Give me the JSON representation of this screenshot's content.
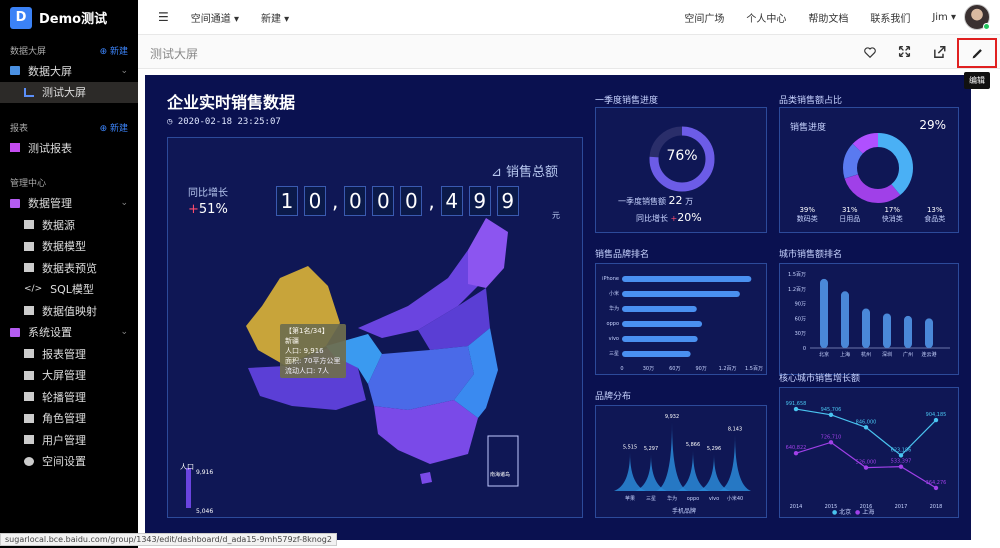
{
  "app": {
    "name": "Demo测试",
    "logo_letter": "D"
  },
  "sidebar": {
    "sections": [
      {
        "title": "数据大屏",
        "new_label": "新建"
      },
      {
        "title": "报表",
        "new_label": "新建"
      },
      {
        "title": "管理中心"
      }
    ],
    "bigscreen_group": "数据大屏",
    "bigscreen_item": "测试大屏",
    "report_item": "测试报表",
    "data_mgmt": "数据管理",
    "data_items": [
      "数据源",
      "数据模型",
      "数据表预览",
      "SQL模型",
      "数据值映射"
    ],
    "settings": "系统设置",
    "settings_items": [
      "报表管理",
      "大屏管理",
      "轮播管理",
      "角色管理",
      "用户管理",
      "空间设置"
    ]
  },
  "topbar": {
    "items": [
      "空间通道",
      "新建"
    ],
    "right_items": [
      "空间广场",
      "个人中心",
      "帮助文档",
      "联系我们"
    ],
    "user": "Jim"
  },
  "subbar": {
    "title": "测试大屏",
    "edit_tooltip": "编辑"
  },
  "dashboard": {
    "title": "企业实时销售数据",
    "datetime": "2020-02-18 23:25:07",
    "sales_total_label": "销售总额",
    "yoy_label": "同比增长",
    "yoy_sign": "+",
    "yoy_value": "51%",
    "digits": [
      "1",
      "0",
      ",",
      "0",
      "0",
      "0",
      ",",
      "4",
      "9",
      "9"
    ],
    "unit": "元",
    "map_tooltip": [
      "【第1名/34】",
      "新疆",
      "人口: 9,916",
      "面积: 70平方公里",
      "流动人口: 7人"
    ],
    "legend_title": "人口",
    "legend_max": "9,916",
    "legend_min": "5,046",
    "south_sea": "南海诸岛"
  },
  "quarter": {
    "title": "一季度销售进度",
    "percent": "76%",
    "sales_label": "一季度销售额",
    "sales_value": "22",
    "sales_unit": "万",
    "yoy_label": "同比增长",
    "yoy_sign": "+",
    "yoy_value": "20%"
  },
  "category": {
    "title": "品类销售额占比",
    "progress_label": "销售进度",
    "progress_value": "29%",
    "items": [
      {
        "value": "39%",
        "label": "数码类"
      },
      {
        "value": "31%",
        "label": "日用品"
      },
      {
        "value": "17%",
        "label": "快消类"
      },
      {
        "value": "13%",
        "label": "食品类"
      }
    ]
  },
  "brand_rank": {
    "title": "销售品牌排名"
  },
  "city_sales": {
    "title": "城市销售额排名"
  },
  "brand_dist": {
    "title": "品牌分布",
    "legend": "手机品牌"
  },
  "city_growth": {
    "title": "核心城市销售增长额",
    "legend": [
      "北京",
      "上海"
    ]
  },
  "status_url": "sugarlocal.bce.baidu.com/group/1343/edit/dashboard/d_ada15-9mh579zf-8knog2",
  "chart_data": [
    {
      "type": "bar",
      "title": "销售品牌排名",
      "categories": [
        "iPhone",
        "小米",
        "华为",
        "oppo",
        "vivo",
        "三星"
      ],
      "values": [
        147000,
        134000,
        85000,
        91000,
        86000,
        78000
      ],
      "xlim": [
        0,
        150000
      ],
      "x_ticks": [
        "0",
        "30万",
        "60万",
        "90万",
        "1.2百万",
        "1.5百万"
      ]
    },
    {
      "type": "bar",
      "title": "城市销售额排名",
      "categories": [
        "北京",
        "上海",
        "杭州",
        "深圳",
        "广州",
        "连云港"
      ],
      "values": [
        1400000,
        1150000,
        800000,
        700000,
        650000,
        600000
      ],
      "ylim": [
        0,
        1500000
      ],
      "y_ticks": [
        "0",
        "30万",
        "60万",
        "90万",
        "1.2百万",
        "1.5百万"
      ]
    },
    {
      "type": "area",
      "title": "品牌分布",
      "categories": [
        "苹果",
        "三星",
        "华为",
        "oppo",
        "vivo",
        "小米40"
      ],
      "values": [
        5515,
        5297,
        9932,
        5866,
        5296,
        8143
      ]
    },
    {
      "type": "line",
      "title": "核心城市销售增长额",
      "x": [
        "2014",
        "2015",
        "2016",
        "2017",
        "2018"
      ],
      "series": [
        {
          "name": "北京",
          "values": [
            991658,
            945706,
            846000,
            623196,
            904185
          ]
        },
        {
          "name": "上海",
          "values": [
            640822,
            726710,
            526000,
            533397,
            364276
          ]
        }
      ]
    },
    {
      "type": "pie",
      "title": "品类销售额占比",
      "categories": [
        "数码类",
        "日用品",
        "快消类",
        "食品类"
      ],
      "values": [
        39,
        31,
        17,
        13
      ]
    }
  ]
}
